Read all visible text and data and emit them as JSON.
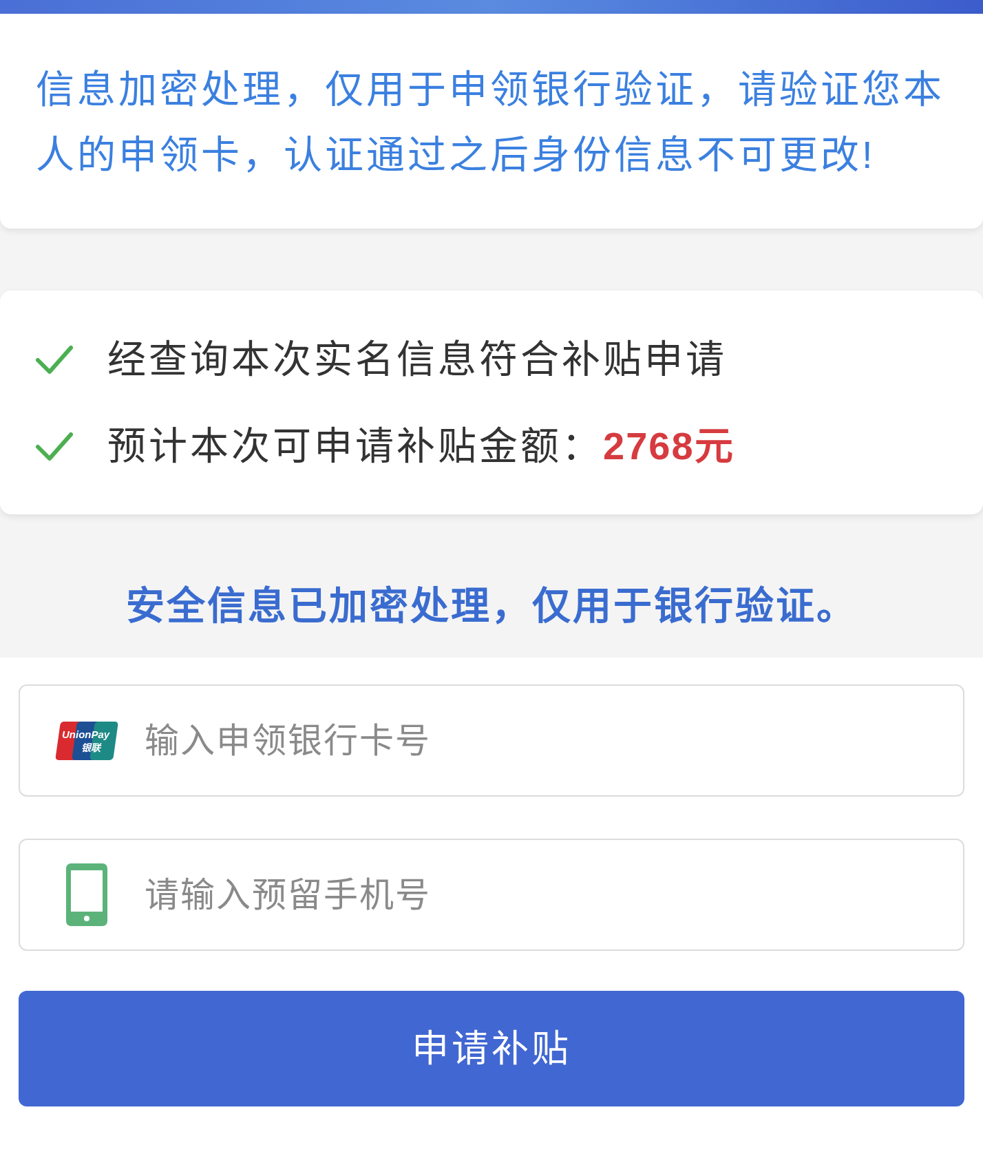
{
  "notice": {
    "text": "信息加密处理，仅用于申领银行验证，请验证您本人的申领卡，认证通过之后身份信息不可更改!"
  },
  "checks": [
    {
      "text": "经查询本次实名信息符合补贴申请",
      "checked": true
    },
    {
      "text": "预计本次可申请补贴金额：",
      "amount": "2768元",
      "checked": true
    }
  ],
  "security_note": "安全信息已加密处理，仅用于银行验证。",
  "fields": [
    {
      "kind": "bank_card",
      "placeholder": "输入申领银行卡号",
      "logo": {
        "latin": "UnionPay",
        "chinese": "银联"
      }
    },
    {
      "kind": "phone",
      "placeholder": "请输入预留手机号"
    }
  ],
  "submit_button": {
    "label": "申请补贴"
  }
}
